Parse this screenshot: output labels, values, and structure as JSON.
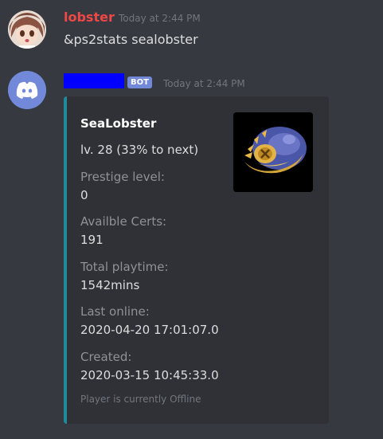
{
  "messages": [
    {
      "username": "lobster",
      "timestamp": "Today at 2:44 PM",
      "content": "&ps2stats sealobster",
      "name_color": "#f04747"
    }
  ],
  "bot_message": {
    "bot_tag": "BOT",
    "timestamp": "Today at 2:44 PM",
    "embed": {
      "accent_color": "#1f8b9c",
      "title": "SeaLobster",
      "description": "lv. 28 (33% to next)",
      "fields": [
        {
          "name": "Prestige level:",
          "value": "0"
        },
        {
          "name": "Availble Certs:",
          "value": "191"
        },
        {
          "name": "Total playtime:",
          "value": "1542mins"
        },
        {
          "name": "Last online:",
          "value": "2020-04-20 17:01:07.0"
        },
        {
          "name": "Created:",
          "value": "2020-03-15 10:45:33.0"
        }
      ],
      "footer": "Player is currently Offline"
    }
  }
}
